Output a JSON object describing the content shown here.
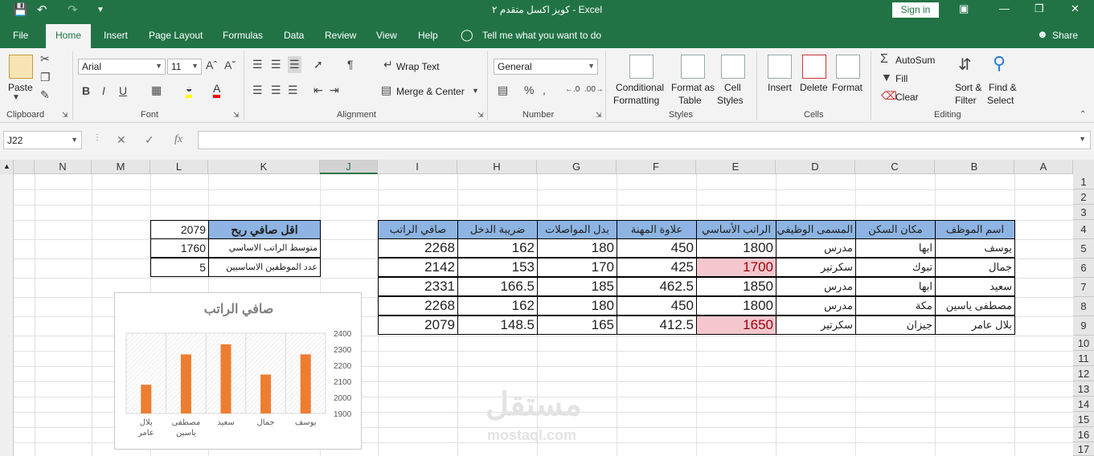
{
  "titlebar": {
    "title": "كويز اكسل متقدم ٢  -  Excel",
    "sign_in": "Sign in"
  },
  "tabs": [
    "File",
    "Home",
    "Insert",
    "Page Layout",
    "Formulas",
    "Data",
    "Review",
    "View",
    "Help"
  ],
  "tell_me": "Tell me what you want to do",
  "share": "Share",
  "ribbon": {
    "clipboard": {
      "paste": "Paste",
      "label": "Clipboard"
    },
    "font": {
      "name": "Arial",
      "size": "11",
      "label": "Font",
      "bold": "B",
      "italic": "I",
      "underline": "U"
    },
    "alignment": {
      "wrap_text": "Wrap Text",
      "merge_center": "Merge & Center",
      "label": "Alignment"
    },
    "number": {
      "format": "General",
      "percent": "%",
      "label": "Number"
    },
    "styles": {
      "conditional1": "Conditional",
      "conditional2": "Formatting",
      "format_as1": "Format as",
      "format_as2": "Table",
      "cell_styles1": "Cell",
      "cell_styles2": "Styles",
      "label": "Styles"
    },
    "cells": {
      "insert": "Insert",
      "delete": "Delete",
      "format": "Format",
      "label": "Cells"
    },
    "editing": {
      "autosum": "AutoSum",
      "fill": "Fill",
      "clear": "Clear",
      "sort1": "Sort &",
      "sort2": "Filter",
      "find1": "Find &",
      "find2": "Select",
      "label": "Editing"
    }
  },
  "formula_bar": {
    "name_box": "J22",
    "fx": "fx"
  },
  "columns": [
    "N",
    "M",
    "L",
    "K",
    "J",
    "I",
    "H",
    "G",
    "F",
    "E",
    "D",
    "C",
    "B",
    "A"
  ],
  "rows": [
    "1",
    "2",
    "3",
    "4",
    "5",
    "6",
    "7",
    "8",
    "9",
    "10",
    "11",
    "12",
    "13",
    "14",
    "15",
    "16",
    "17"
  ],
  "table": {
    "headers": [
      "صافي الراتب",
      "ضريبة الدخل",
      "بدل المواصلات",
      "علاوة المهنة",
      "الراتب الأساسي",
      "المسمى الوظيفي",
      "مكان السكن",
      "اسم الموظف"
    ],
    "rows": [
      [
        "2268",
        "162",
        "180",
        "450",
        "1800",
        "مدرس",
        "ابها",
        "يوسف"
      ],
      [
        "2142",
        "153",
        "170",
        "425",
        "1700",
        "سكرتير",
        "تبوك",
        "جمال"
      ],
      [
        "2331",
        "166.5",
        "185",
        "462.5",
        "1850",
        "مدرس",
        "ابها",
        "سعيد"
      ],
      [
        "2268",
        "162",
        "180",
        "450",
        "1800",
        "مدرس",
        "مكة",
        "مصطفى ياسين"
      ],
      [
        "2079",
        "148.5",
        "165",
        "412.5",
        "1650",
        "سكرتير",
        "جيزان",
        "بلال عامر"
      ]
    ]
  },
  "summary": {
    "title_label": "اقل صافي ربح",
    "title_value": "2079",
    "avg_label": "متوسط الراتب الاساسي",
    "avg_value": "1760",
    "count_label": "عدد الموظفين الاساسيين",
    "count_value": "5"
  },
  "chart_data": {
    "type": "bar",
    "title": "صافي الراتب",
    "categories": [
      "بلال عامر",
      "مصطفى ياسين",
      "سعيد",
      "جمال",
      "يوسف"
    ],
    "values": [
      2079,
      2268,
      2331,
      2142,
      2268
    ],
    "ylim": [
      1900,
      2400
    ],
    "yticks": [
      "2400",
      "2300",
      "2200",
      "2100",
      "2000",
      "1900"
    ],
    "color": "#ed7d31"
  },
  "watermark": {
    "arabic": "مستقل",
    "latin": "mostaql.com"
  }
}
